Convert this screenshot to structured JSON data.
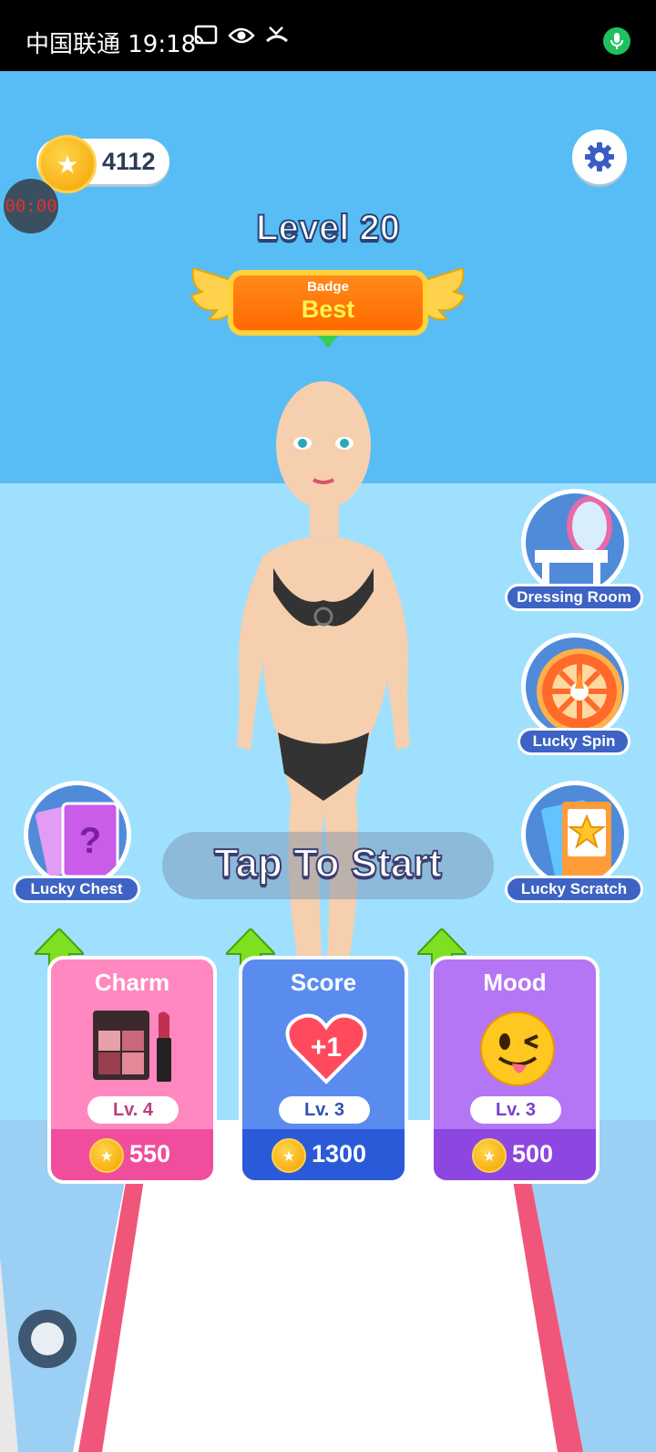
{
  "status_bar": {
    "carrier_time": "中国联通 19:18",
    "icons": [
      "cast-icon",
      "eye-icon",
      "missed-call-icon"
    ],
    "mic_icon": "microphone-icon"
  },
  "hud": {
    "coins": "4112",
    "timer": "00:00",
    "settings_icon": "gear-icon"
  },
  "level": {
    "title": "Level 20",
    "badge_label": "Badge",
    "badge_value": "Best"
  },
  "side_buttons": {
    "dressing_room": "Dressing Room",
    "lucky_spin": "Lucky Spin",
    "lucky_chest": "Lucky Chest",
    "lucky_scratch": "Lucky Scratch"
  },
  "start": {
    "label": "Tap To Start"
  },
  "upgrades": [
    {
      "title": "Charm",
      "level": "Lv. 4",
      "price": "550",
      "icon": "makeup-palette-icon"
    },
    {
      "title": "Score",
      "level": "Lv. 3",
      "price": "1300",
      "icon": "heart-plus-one-icon",
      "icon_text": "+1"
    },
    {
      "title": "Mood",
      "level": "Lv. 3",
      "price": "500",
      "icon": "winking-emoji-icon"
    }
  ],
  "colors": {
    "sky": "#58bdf5",
    "charm_card": "#ff7fb8",
    "score_card": "#5a8cf0",
    "mood_card": "#b06ff0",
    "badge": "#ff7010"
  }
}
